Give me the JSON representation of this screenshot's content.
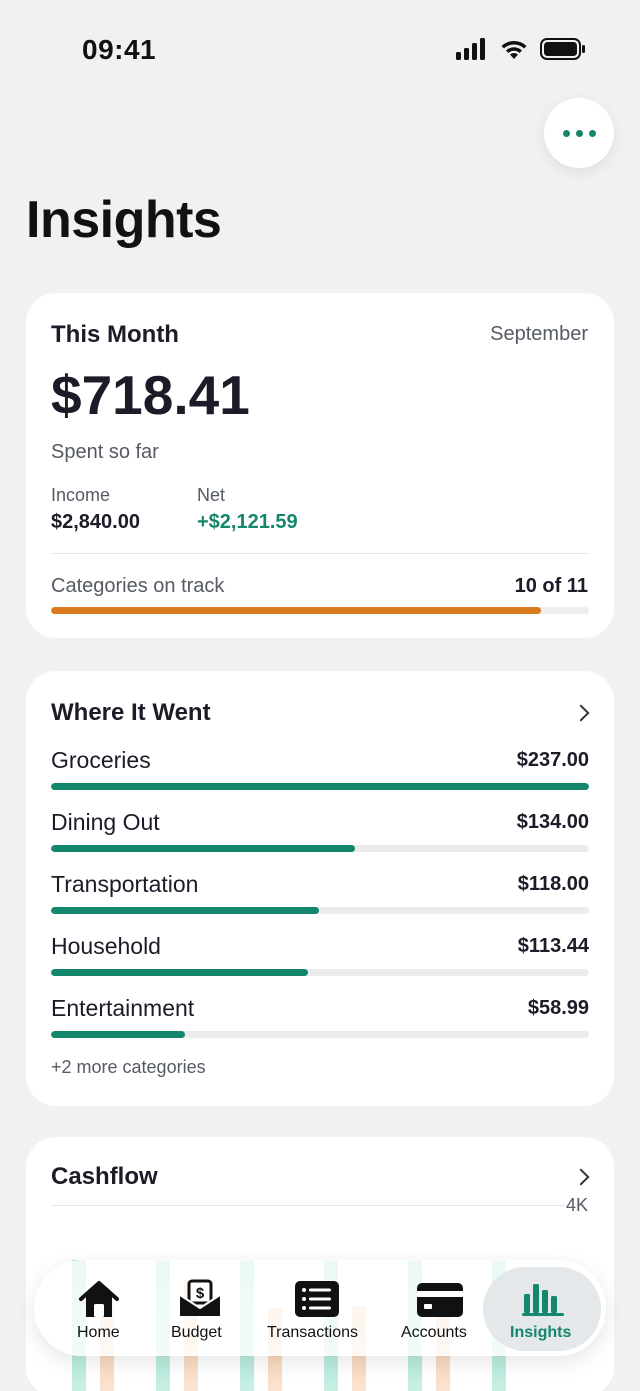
{
  "status": {
    "time": "09:41"
  },
  "page": {
    "title": "Insights"
  },
  "this_month": {
    "title": "This Month",
    "month": "September",
    "amount": "$718.41",
    "subtitle": "Spent so far",
    "income_label": "Income",
    "income_value": "$2,840.00",
    "net_label": "Net",
    "net_value": "+$2,121.59",
    "track_label": "Categories on track",
    "track_value": "10 of 11",
    "track_fraction": 0.91,
    "track_color": "#d97b1a"
  },
  "where": {
    "title": "Where It Went",
    "categories": [
      {
        "name": "Groceries",
        "amount": "$237.00",
        "fraction": 1.0
      },
      {
        "name": "Dining Out",
        "amount": "$134.00",
        "fraction": 0.565
      },
      {
        "name": "Transportation",
        "amount": "$118.00",
        "fraction": 0.498
      },
      {
        "name": "Household",
        "amount": "$113.44",
        "fraction": 0.478
      },
      {
        "name": "Entertainment",
        "amount": "$58.99",
        "fraction": 0.249
      }
    ],
    "more": "+2 more categories"
  },
  "cashflow": {
    "title": "Cashflow",
    "axis_top": "4K"
  },
  "tabbar": {
    "items": [
      {
        "label": "Home",
        "icon": "home-icon"
      },
      {
        "label": "Budget",
        "icon": "budget-envelope-icon"
      },
      {
        "label": "Transactions",
        "icon": "transactions-list-icon"
      },
      {
        "label": "Accounts",
        "icon": "credit-card-icon"
      },
      {
        "label": "Insights",
        "icon": "bar-chart-icon"
      }
    ],
    "active": "Insights"
  },
  "colors": {
    "accent": "#14866b",
    "warning": "#d97b1a",
    "background": "#f0f1f3"
  }
}
